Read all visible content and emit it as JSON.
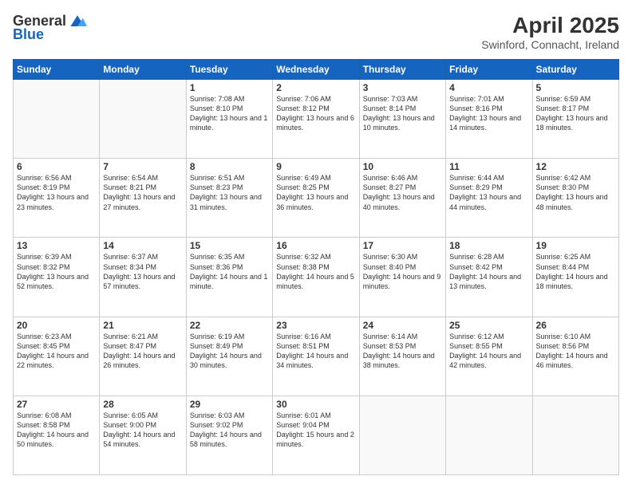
{
  "header": {
    "logo_general": "General",
    "logo_blue": "Blue",
    "title": "April 2025",
    "location": "Swinford, Connacht, Ireland"
  },
  "days_of_week": [
    "Sunday",
    "Monday",
    "Tuesday",
    "Wednesday",
    "Thursday",
    "Friday",
    "Saturday"
  ],
  "weeks": [
    [
      {
        "day": "",
        "info": ""
      },
      {
        "day": "",
        "info": ""
      },
      {
        "day": "1",
        "info": "Sunrise: 7:08 AM\nSunset: 8:10 PM\nDaylight: 13 hours and 1 minute."
      },
      {
        "day": "2",
        "info": "Sunrise: 7:06 AM\nSunset: 8:12 PM\nDaylight: 13 hours and 6 minutes."
      },
      {
        "day": "3",
        "info": "Sunrise: 7:03 AM\nSunset: 8:14 PM\nDaylight: 13 hours and 10 minutes."
      },
      {
        "day": "4",
        "info": "Sunrise: 7:01 AM\nSunset: 8:16 PM\nDaylight: 13 hours and 14 minutes."
      },
      {
        "day": "5",
        "info": "Sunrise: 6:59 AM\nSunset: 8:17 PM\nDaylight: 13 hours and 18 minutes."
      }
    ],
    [
      {
        "day": "6",
        "info": "Sunrise: 6:56 AM\nSunset: 8:19 PM\nDaylight: 13 hours and 23 minutes."
      },
      {
        "day": "7",
        "info": "Sunrise: 6:54 AM\nSunset: 8:21 PM\nDaylight: 13 hours and 27 minutes."
      },
      {
        "day": "8",
        "info": "Sunrise: 6:51 AM\nSunset: 8:23 PM\nDaylight: 13 hours and 31 minutes."
      },
      {
        "day": "9",
        "info": "Sunrise: 6:49 AM\nSunset: 8:25 PM\nDaylight: 13 hours and 36 minutes."
      },
      {
        "day": "10",
        "info": "Sunrise: 6:46 AM\nSunset: 8:27 PM\nDaylight: 13 hours and 40 minutes."
      },
      {
        "day": "11",
        "info": "Sunrise: 6:44 AM\nSunset: 8:29 PM\nDaylight: 13 hours and 44 minutes."
      },
      {
        "day": "12",
        "info": "Sunrise: 6:42 AM\nSunset: 8:30 PM\nDaylight: 13 hours and 48 minutes."
      }
    ],
    [
      {
        "day": "13",
        "info": "Sunrise: 6:39 AM\nSunset: 8:32 PM\nDaylight: 13 hours and 52 minutes."
      },
      {
        "day": "14",
        "info": "Sunrise: 6:37 AM\nSunset: 8:34 PM\nDaylight: 13 hours and 57 minutes."
      },
      {
        "day": "15",
        "info": "Sunrise: 6:35 AM\nSunset: 8:36 PM\nDaylight: 14 hours and 1 minute."
      },
      {
        "day": "16",
        "info": "Sunrise: 6:32 AM\nSunset: 8:38 PM\nDaylight: 14 hours and 5 minutes."
      },
      {
        "day": "17",
        "info": "Sunrise: 6:30 AM\nSunset: 8:40 PM\nDaylight: 14 hours and 9 minutes."
      },
      {
        "day": "18",
        "info": "Sunrise: 6:28 AM\nSunset: 8:42 PM\nDaylight: 14 hours and 13 minutes."
      },
      {
        "day": "19",
        "info": "Sunrise: 6:25 AM\nSunset: 8:44 PM\nDaylight: 14 hours and 18 minutes."
      }
    ],
    [
      {
        "day": "20",
        "info": "Sunrise: 6:23 AM\nSunset: 8:45 PM\nDaylight: 14 hours and 22 minutes."
      },
      {
        "day": "21",
        "info": "Sunrise: 6:21 AM\nSunset: 8:47 PM\nDaylight: 14 hours and 26 minutes."
      },
      {
        "day": "22",
        "info": "Sunrise: 6:19 AM\nSunset: 8:49 PM\nDaylight: 14 hours and 30 minutes."
      },
      {
        "day": "23",
        "info": "Sunrise: 6:16 AM\nSunset: 8:51 PM\nDaylight: 14 hours and 34 minutes."
      },
      {
        "day": "24",
        "info": "Sunrise: 6:14 AM\nSunset: 8:53 PM\nDaylight: 14 hours and 38 minutes."
      },
      {
        "day": "25",
        "info": "Sunrise: 6:12 AM\nSunset: 8:55 PM\nDaylight: 14 hours and 42 minutes."
      },
      {
        "day": "26",
        "info": "Sunrise: 6:10 AM\nSunset: 8:56 PM\nDaylight: 14 hours and 46 minutes."
      }
    ],
    [
      {
        "day": "27",
        "info": "Sunrise: 6:08 AM\nSunset: 8:58 PM\nDaylight: 14 hours and 50 minutes."
      },
      {
        "day": "28",
        "info": "Sunrise: 6:05 AM\nSunset: 9:00 PM\nDaylight: 14 hours and 54 minutes."
      },
      {
        "day": "29",
        "info": "Sunrise: 6:03 AM\nSunset: 9:02 PM\nDaylight: 14 hours and 58 minutes."
      },
      {
        "day": "30",
        "info": "Sunrise: 6:01 AM\nSunset: 9:04 PM\nDaylight: 15 hours and 2 minutes."
      },
      {
        "day": "",
        "info": ""
      },
      {
        "day": "",
        "info": ""
      },
      {
        "day": "",
        "info": ""
      }
    ]
  ]
}
